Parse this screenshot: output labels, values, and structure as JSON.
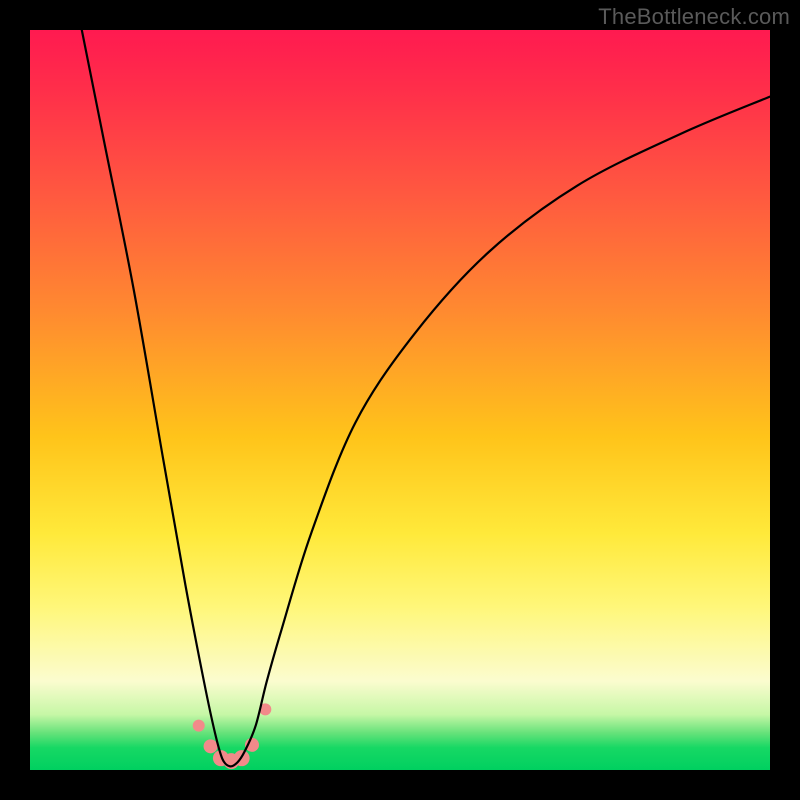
{
  "attribution": "TheBottleneck.com",
  "chart_data": {
    "type": "line",
    "title": "",
    "xlabel": "",
    "ylabel": "",
    "xlim": [
      0,
      100
    ],
    "ylim": [
      0,
      100
    ],
    "series": [
      {
        "name": "bottleneck-curve",
        "description": "V-shaped bottleneck curve dipping to near-zero near x≈27",
        "color": "#000000",
        "x": [
          7,
          10,
          14,
          18,
          21,
          23.5,
          25,
          26,
          27,
          28,
          29,
          30.5,
          32,
          34,
          38,
          44,
          52,
          62,
          74,
          88,
          100
        ],
        "y": [
          100,
          85,
          65,
          42,
          25,
          12,
          5,
          1.5,
          0.5,
          1,
          2.5,
          6,
          12,
          19,
          32,
          47,
          59,
          70,
          79,
          86,
          91
        ]
      }
    ],
    "markers": {
      "name": "highlight-dots",
      "color": "#f28a8a",
      "points": [
        {
          "x": 22.8,
          "y": 6.0,
          "r": 6
        },
        {
          "x": 24.4,
          "y": 3.2,
          "r": 7
        },
        {
          "x": 25.8,
          "y": 1.6,
          "r": 8
        },
        {
          "x": 27.2,
          "y": 1.2,
          "r": 8
        },
        {
          "x": 28.6,
          "y": 1.6,
          "r": 8
        },
        {
          "x": 30.0,
          "y": 3.4,
          "r": 7
        },
        {
          "x": 31.8,
          "y": 8.2,
          "r": 6
        }
      ]
    },
    "background_gradient_stops": [
      {
        "pct": 0,
        "color": "#ff1a50"
      },
      {
        "pct": 55,
        "color": "#ffc41a"
      },
      {
        "pct": 78,
        "color": "#fff77a"
      },
      {
        "pct": 95,
        "color": "#66e27a"
      },
      {
        "pct": 100,
        "color": "#00d060"
      }
    ]
  }
}
